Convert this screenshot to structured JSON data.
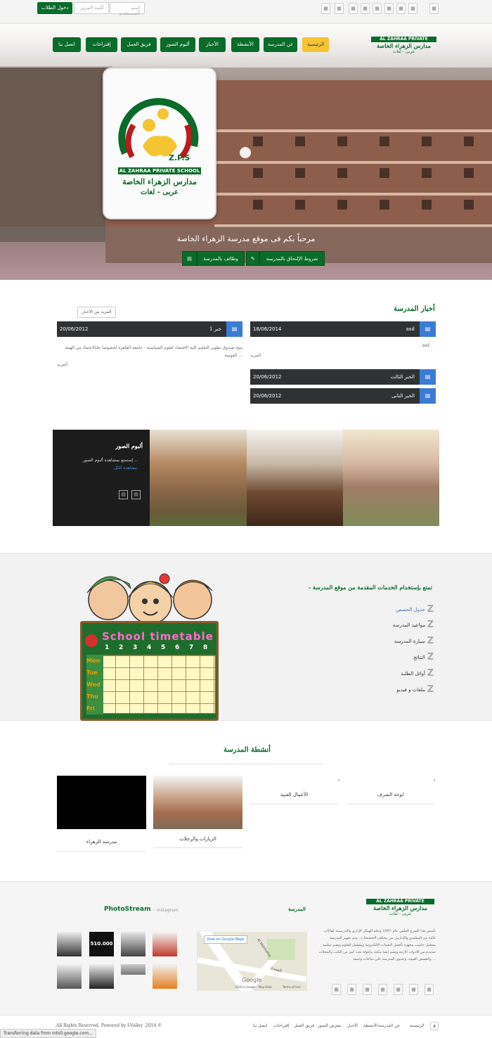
{
  "topbar": {
    "username_placeholder": "إسم المستخدم",
    "password_placeholder": "كلمة المرور",
    "login_label": "دخول الطلاب"
  },
  "logo": {
    "en": "AL ZAHRAA PRIVATE SCHOOL",
    "ar": "مدارس الزهراء الخاصة",
    "sub": "عربى - لغات",
    "initials": "Z.P.S"
  },
  "nav": {
    "home": "الرئيسية",
    "about": "عن المدرسة",
    "activities": "الأنشطة",
    "news": "الأخبار",
    "gallery": "ألبوم الصور",
    "team": "فريق العمل",
    "suggestions": "إقتراحات",
    "contact": "اتصل بنا"
  },
  "hero": {
    "welcome": "مرحباً بكم فى موقع مدرسة الزهراء الخاصة",
    "btn_admission": "شروط الإلتحاق بالمدرسة",
    "btn_jobs": "وظائف بالمدرسة"
  },
  "news": {
    "title": "أخبار المدرسة",
    "more_news": "المزيد من الأخبار",
    "featured": {
      "title": "asd",
      "date": "18/06/2014",
      "excerpt": "asd",
      "more": "المزيد"
    },
    "left": {
      "title": "خبر 1",
      "date": "20/06/2012",
      "excerpt": "يتيح صندوق تطوير التعليم كلية الاقتصاد لعلوم السياسية - جامعة القاهرة لخصوصا علىالاعتماد من الهيئة القومية ...",
      "more": "المزيد"
    },
    "item3": {
      "title": "الخبر الثالث",
      "date": "20/06/2012"
    },
    "item2": {
      "title": "الخبر التانى",
      "date": "20/06/2012"
    }
  },
  "gallery": {
    "title": "ألبوم الصور",
    "text": "إستمتع بمشاهدة ألبوم الصور ..",
    "link": "مشاهدة الكل"
  },
  "services": {
    "title": "- تمتع بإستخدام الخدمات المقدمة من موقع المدرسة",
    "items": [
      "جدول الحصص",
      "مواعيد المدرسة",
      "سيارة المدرسة",
      "النتائج",
      "أوائل الطلبة",
      "ملفات و فيديو"
    ],
    "poster_title": "School timetable",
    "days": [
      "Mon",
      "Tue",
      "Wed",
      "Thu",
      "Fri"
    ],
    "nums": [
      "1",
      "2",
      "3",
      "4",
      "5",
      "6",
      "7",
      "8"
    ]
  },
  "activities": {
    "title": "أنشطة المدرسة",
    "items": [
      "لوحة الشرف",
      "الأعمال الفنية",
      "الزيارات والرحلات",
      "مدرسة الزهراء"
    ]
  },
  "footer": {
    "about": "تأسس هذا الصرح العلمي عام 1997 ونعلم الهيكل الإداري والتدريسية كفاءات عالية من المعلمين والإداريين من مختلف التخصصات ، وتم تجهيز المدرسة بمعامل حاسب مجهزة بأفضل التقنيات الالكترونية وممعمل للعلوم ويضم سلسة تمديدم من الادوات الازمة ويضم ايضا مكتبة ماعولة بعدد كبير من الكتب والمجلات والقصص القيمه، وتحتوي المدرسة على ساحات واسعة ...",
    "map_title": "المدرسة",
    "map_link": "View on Google Maps",
    "map_copy": "©2014 Google - Map Data",
    "map_terms": "Terms of Use",
    "map_google": "Google",
    "map_street1": "Al Mahkama",
    "map_street2": "العمدة",
    "photostream": "PhotoStream",
    "instagram": "- Instagram",
    "thumb_510": "510.000"
  },
  "bottom": {
    "copyright": "© 2014. All Rights Reserved. Powered by I-Valley.",
    "links": [
      "الرئيسية",
      "عن المدرسة",
      "الأنشطة",
      "الأخبار",
      "معرض الصور",
      "فريق العمل",
      "إقتراحات",
      "اتصل بنا"
    ],
    "status": "Transferring data from mts0.google.com..."
  },
  "colors": {
    "green": "#0a6b2a",
    "yellow": "#f4c431",
    "blue": "#3a7bd5",
    "dark": "#2f3133"
  }
}
